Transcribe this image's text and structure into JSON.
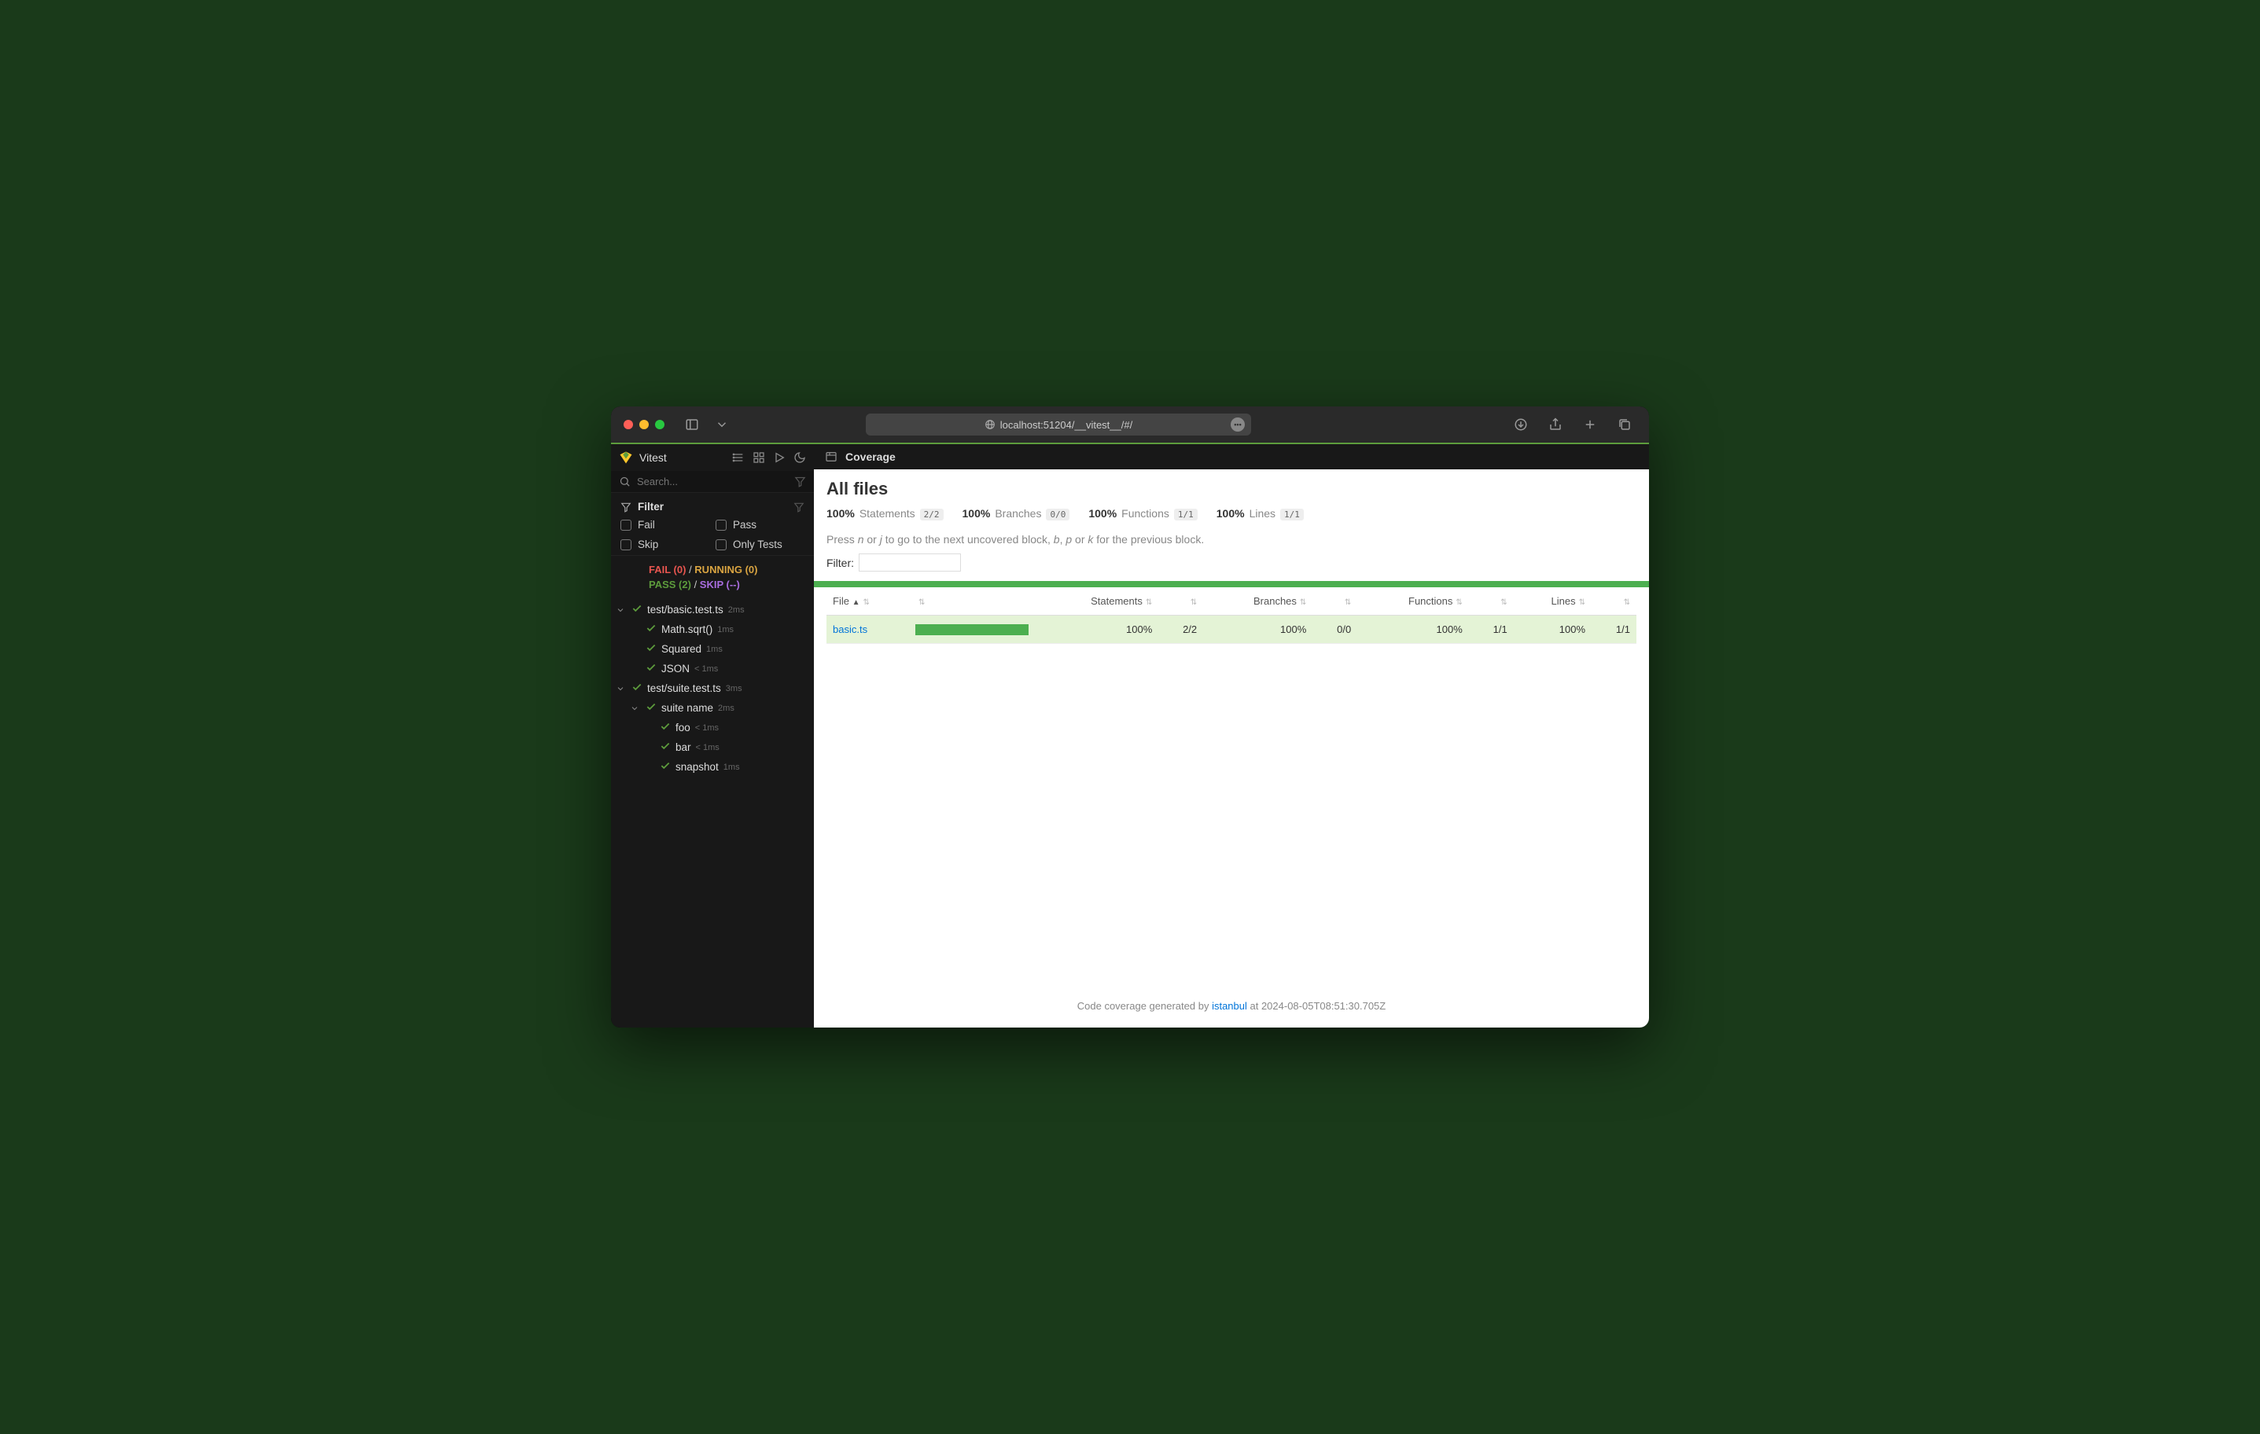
{
  "browser": {
    "url": "localhost:51204/__vitest__/#/",
    "tooltip": "•••"
  },
  "sidebar": {
    "title": "Vitest",
    "search_placeholder": "Search...",
    "filter_label": "Filter",
    "options": {
      "fail": "Fail",
      "pass": "Pass",
      "skip": "Skip",
      "only": "Only Tests"
    },
    "status": {
      "fail": "FAIL (0)",
      "running": "RUNNING (0)",
      "pass": "PASS (2)",
      "skip": "SKIP (--)"
    },
    "tree": [
      {
        "indent": 0,
        "chevron": true,
        "label": "test/basic.test.ts",
        "time": "2ms"
      },
      {
        "indent": 1,
        "chevron": false,
        "label": "Math.sqrt()",
        "time": "1ms"
      },
      {
        "indent": 1,
        "chevron": false,
        "label": "Squared",
        "time": "1ms"
      },
      {
        "indent": 1,
        "chevron": false,
        "label": "JSON",
        "time": "< 1ms"
      },
      {
        "indent": 0,
        "chevron": true,
        "label": "test/suite.test.ts",
        "time": "3ms"
      },
      {
        "indent": 1,
        "chevron": true,
        "label": "suite name",
        "time": "2ms"
      },
      {
        "indent": 2,
        "chevron": false,
        "label": "foo",
        "time": "< 1ms"
      },
      {
        "indent": 2,
        "chevron": false,
        "label": "bar",
        "time": "< 1ms"
      },
      {
        "indent": 2,
        "chevron": false,
        "label": "snapshot",
        "time": "1ms"
      }
    ]
  },
  "coverage": {
    "header": "Coverage",
    "title": "All files",
    "summary": [
      {
        "pct": "100%",
        "label": "Statements",
        "badge": "2/2"
      },
      {
        "pct": "100%",
        "label": "Branches",
        "badge": "0/0"
      },
      {
        "pct": "100%",
        "label": "Functions",
        "badge": "1/1"
      },
      {
        "pct": "100%",
        "label": "Lines",
        "badge": "1/1"
      }
    ],
    "hint_pre": "Press ",
    "hint_keys1": "n",
    "hint_mid1": " or ",
    "hint_keys2": "j",
    "hint_mid2": " to go to the next uncovered block, ",
    "hint_keys3": "b",
    "hint_mid3": ", ",
    "hint_keys4": "p",
    "hint_mid4": " or ",
    "hint_keys5": "k",
    "hint_post": " for the previous block.",
    "filter_label": "Filter:",
    "columns": [
      "File",
      "",
      "Statements",
      "",
      "Branches",
      "",
      "Functions",
      "",
      "Lines",
      ""
    ],
    "rows": [
      {
        "file": "basic.ts",
        "stmt_pct": "100%",
        "stmt_frac": "2/2",
        "branch_pct": "100%",
        "branch_frac": "0/0",
        "func_pct": "100%",
        "func_frac": "1/1",
        "line_pct": "100%",
        "line_frac": "1/1"
      }
    ],
    "footer_pre": "Code coverage generated by ",
    "footer_link": "istanbul",
    "footer_post": " at 2024-08-05T08:51:30.705Z"
  }
}
